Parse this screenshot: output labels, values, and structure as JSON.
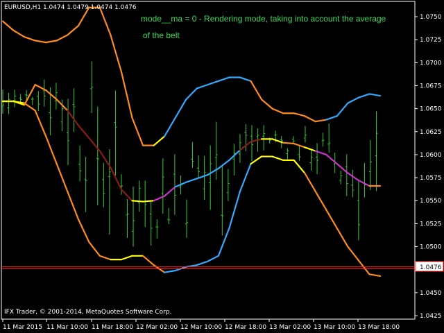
{
  "header": {
    "symbol_info": "EURUSD,H1  1.0474 1.0479 1.0474 1.0476",
    "note_line1": "mode__ma = 0 - Rendering mode, taking into account the average",
    "note_line2": "of the belt"
  },
  "footer": {
    "copyright": "IFX Trader, © 2001-2014, MetaQuotes Software Corp."
  },
  "price_badge": "1.0476",
  "colors": {
    "background": "#000000",
    "axis": "#ffffff",
    "candles": "#33cc33",
    "upper_band": "#ff8c1a",
    "lower_band": "#ff8c1a",
    "rising": "#33aaff",
    "flat": "#ffff00",
    "falling": "#cc33cc",
    "mid_dark": "#8b1a1a",
    "price_line": "#ff2222"
  },
  "chart_data": {
    "type": "line",
    "symbol": "EURUSD",
    "timeframe": "H1",
    "ylim": [
      1.0425,
      1.0775
    ],
    "y_ticks": [
      "1.0750",
      "1.0725",
      "1.0700",
      "1.0675",
      "1.0650",
      "1.0625",
      "1.0600",
      "1.0575",
      "1.0550",
      "1.0525",
      "1.0500",
      "1.0475",
      "1.0450",
      "1.0425"
    ],
    "x_ticks": [
      "11 Mar 2015",
      "11 Mar 10:00",
      "11 Mar 18:00",
      "12 Mar 02:00",
      "12 Mar 10:00",
      "12 Mar 18:00",
      "13 Mar 02:00",
      "13 Mar 10:00",
      "13 Mar 18:00"
    ],
    "current_price": 1.0476,
    "series": [
      {
        "name": "",
        "role": "upper",
        "x": [
          0,
          4,
          8,
          12,
          16,
          20,
          24,
          28,
          32,
          36,
          40,
          44,
          48,
          52,
          56,
          60,
          64,
          68,
          72,
          76,
          80,
          84,
          88,
          92,
          96,
          100,
          104,
          108,
          112,
          116,
          120,
          124,
          128,
          132,
          136,
          140
        ],
        "y": [
          1.0745,
          1.0735,
          1.0728,
          1.0724,
          1.0722,
          1.0724,
          1.073,
          1.074,
          1.076,
          1.076,
          1.073,
          1.069,
          1.064,
          1.061,
          1.061,
          1.062,
          1.064,
          1.066,
          1.0672,
          1.0676,
          1.068,
          1.0684,
          1.0684,
          1.068,
          1.066,
          1.065,
          1.0645,
          1.0645,
          1.0642,
          1.0636,
          1.0638,
          1.0642,
          1.0656,
          1.0662,
          1.0666,
          1.0664
        ],
        "segments": [
          "upper",
          "upper",
          "upper",
          "upper",
          "upper",
          "upper",
          "upper",
          "upper",
          "upper",
          "upper",
          "upper",
          "upper",
          "upper",
          "upper",
          "flat",
          "rising",
          "rising",
          "rising",
          "rising",
          "rising",
          "rising",
          "rising",
          "rising",
          "upper",
          "upper",
          "upper",
          "upper",
          "upper",
          "upper",
          "upper",
          "rising",
          "rising",
          "rising",
          "rising",
          "rising",
          "upper"
        ]
      },
      {
        "name": "",
        "role": "middle",
        "x": [
          0,
          4,
          8,
          12,
          16,
          20,
          24,
          28,
          32,
          36,
          40,
          44,
          48,
          52,
          56,
          60,
          64,
          68,
          72,
          76,
          80,
          84,
          88,
          92,
          96,
          100,
          104,
          108,
          112,
          116,
          120,
          124,
          128,
          132,
          136,
          140
        ],
        "y": [
          1.0658,
          1.0658,
          1.0654,
          1.0676,
          1.067,
          1.066,
          1.0648,
          1.0632,
          1.0618,
          1.0604,
          1.0586,
          1.0562,
          1.055,
          1.0549,
          1.055,
          1.0555,
          1.0565,
          1.057,
          1.0574,
          1.0578,
          1.0585,
          1.0594,
          1.0605,
          1.0614,
          1.0617,
          1.0617,
          1.0613,
          1.0612,
          1.0608,
          1.0604,
          1.06,
          1.059,
          1.058,
          1.0572,
          1.0566,
          1.0566
        ],
        "segments": [
          "flat",
          "flat",
          "upper",
          "upper",
          "upper",
          "upper",
          "mid_dark",
          "mid_dark",
          "mid_dark",
          "mid_dark",
          "mid_dark",
          "mid_dark",
          "flat",
          "flat",
          "falling",
          "falling",
          "rising",
          "rising",
          "rising",
          "rising",
          "rising",
          "rising",
          "mid_dark",
          "mid_dark",
          "flat",
          "flat",
          "upper",
          "upper",
          "flat",
          "falling",
          "falling",
          "falling",
          "falling",
          "falling",
          "upper",
          "upper"
        ]
      },
      {
        "name": "",
        "role": "lower",
        "x": [
          0,
          4,
          8,
          12,
          16,
          20,
          24,
          28,
          32,
          36,
          40,
          44,
          48,
          52,
          56,
          60,
          64,
          68,
          72,
          76,
          80,
          84,
          88,
          92,
          96,
          100,
          104,
          108,
          112,
          116,
          120,
          124,
          128,
          132,
          136,
          140
        ],
        "y": [
          1.0658,
          1.0658,
          1.0656,
          1.0648,
          1.062,
          1.059,
          1.056,
          1.053,
          1.0505,
          1.049,
          1.0486,
          1.0486,
          1.049,
          1.049,
          1.048,
          1.0472,
          1.0474,
          1.0478,
          1.048,
          1.0484,
          1.049,
          1.052,
          1.056,
          1.059,
          1.0598,
          1.0598,
          1.0594,
          1.0594,
          1.058,
          1.056,
          1.054,
          1.052,
          1.05,
          1.0485,
          1.047,
          1.0468
        ],
        "segments": [
          "flat",
          "flat",
          "upper",
          "upper",
          "upper",
          "upper",
          "upper",
          "upper",
          "upper",
          "upper",
          "flat",
          "flat",
          "flat",
          "upper",
          "upper",
          "rising",
          "rising",
          "rising",
          "rising",
          "rising",
          "rising",
          "rising",
          "rising",
          "flat",
          "flat",
          "flat",
          "flat",
          "flat",
          "upper",
          "upper",
          "upper",
          "upper",
          "upper",
          "upper",
          "upper",
          "upper"
        ]
      }
    ]
  }
}
